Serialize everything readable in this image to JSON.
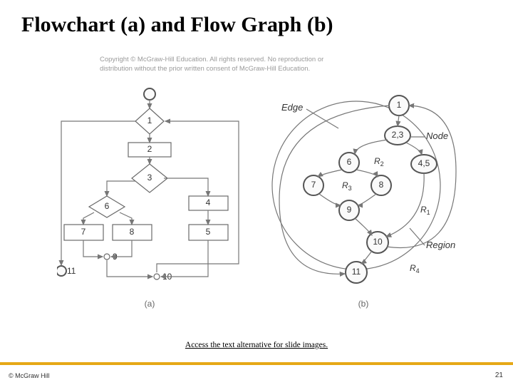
{
  "title": "Flowchart (a) and Flow Graph (b)",
  "copyright_notice": {
    "line1": "Copyright © McGraw-Hill Education. All rights reserved. No reproduction or",
    "line2": "distribution without the prior written consent of McGraw-Hill Education."
  },
  "flowchart": {
    "caption": "(a)",
    "start_node": "start",
    "end_node": "11",
    "decisions": [
      "1",
      "3"
    ],
    "processes": [
      "2",
      "4",
      "5",
      "6",
      "7",
      "8"
    ],
    "connectors": [
      "9",
      "10"
    ],
    "edges": [
      [
        "start",
        "1"
      ],
      [
        "1",
        "2"
      ],
      [
        "1",
        "11"
      ],
      [
        "2",
        "3"
      ],
      [
        "3",
        "6"
      ],
      [
        "3",
        "4"
      ],
      [
        "4",
        "5"
      ],
      [
        "5",
        "10"
      ],
      [
        "6",
        "7"
      ],
      [
        "6",
        "8"
      ],
      [
        "7",
        "9"
      ],
      [
        "8",
        "9"
      ],
      [
        "9",
        "10"
      ],
      [
        "10",
        "1"
      ]
    ]
  },
  "flowgraph": {
    "caption": "(b)",
    "nodes": [
      "1",
      "2,3",
      "4,5",
      "6",
      "7",
      "8",
      "9",
      "10",
      "11"
    ],
    "regions": [
      "R1",
      "R2",
      "R3",
      "R4"
    ],
    "annotations": {
      "edge": "Edge",
      "node": "Node",
      "region": "Region"
    },
    "edges": [
      [
        "1",
        "2,3"
      ],
      [
        "1",
        "11"
      ],
      [
        "2,3",
        "6"
      ],
      [
        "2,3",
        "4,5"
      ],
      [
        "4,5",
        "10"
      ],
      [
        "6",
        "7"
      ],
      [
        "6",
        "8"
      ],
      [
        "7",
        "9"
      ],
      [
        "8",
        "9"
      ],
      [
        "9",
        "10"
      ],
      [
        "10",
        "1"
      ],
      [
        "10",
        "11"
      ]
    ]
  },
  "alt_link": "Access the text alternative for slide images.",
  "footer": {
    "left": "© McGraw Hill",
    "page": "21"
  }
}
